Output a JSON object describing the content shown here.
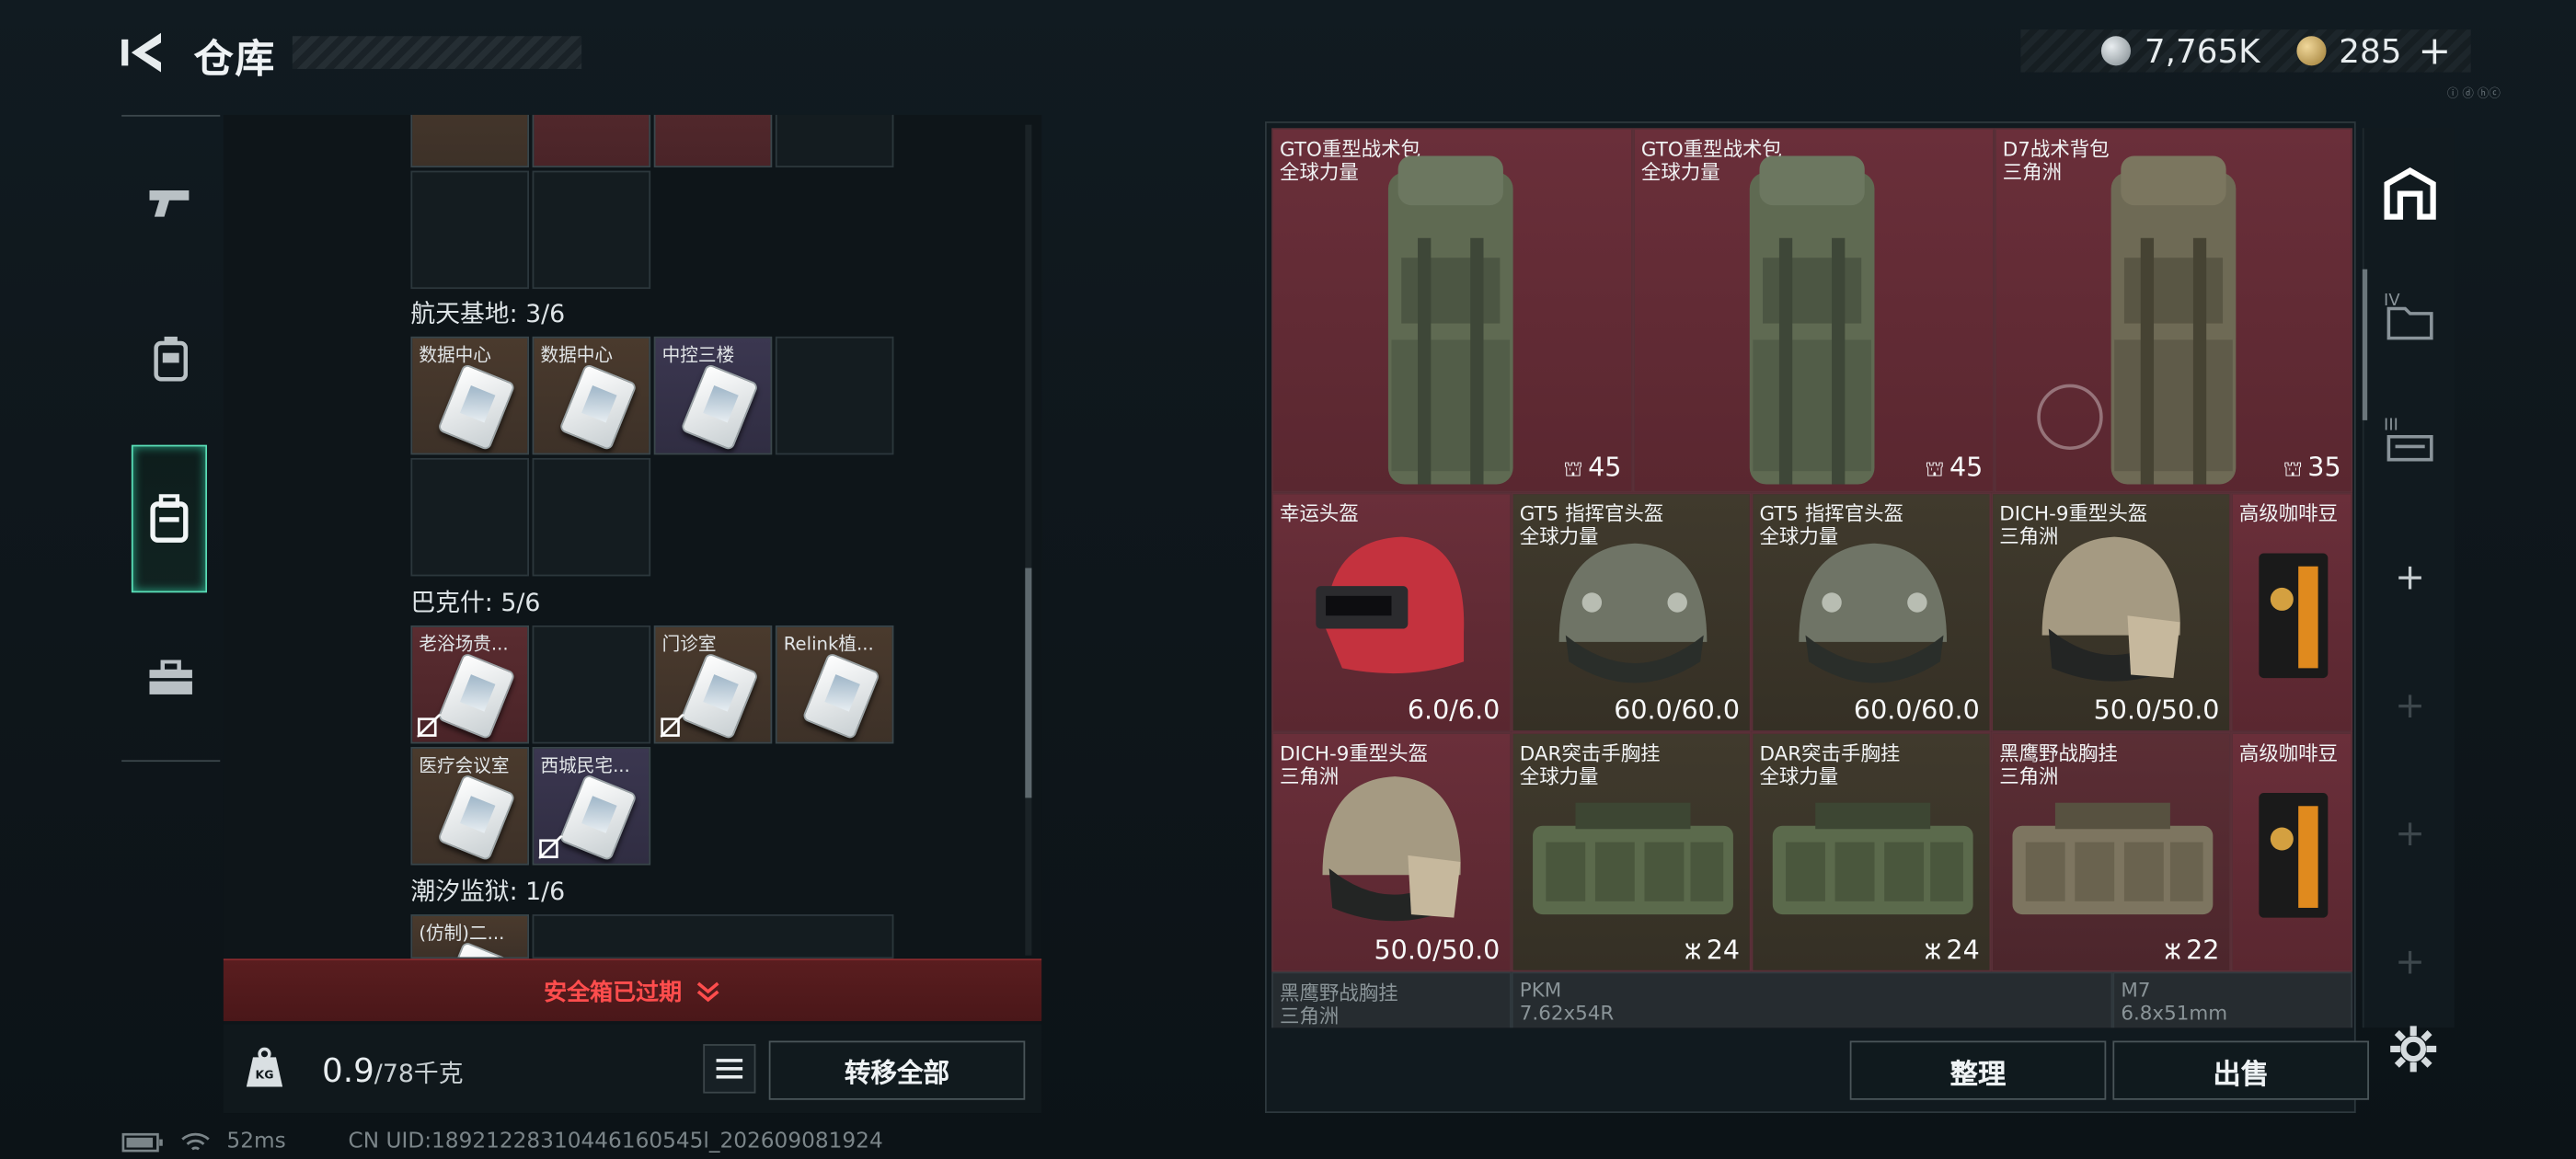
{
  "header": {
    "title": "仓库",
    "currency_silver": "7,765K",
    "currency_gold": "285",
    "plus": "+",
    "tag_text": "ⓘ ⓓ ⓗⓒ"
  },
  "left_sidebar": {
    "items": [
      {
        "icon": "pistol-icon"
      },
      {
        "icon": "chest-rig-icon"
      },
      {
        "icon": "backpack-icon"
      },
      {
        "icon": "toolbox-icon"
      }
    ]
  },
  "keys_panel": {
    "sections": [
      {
        "title": "航天基地: 3/6",
        "items": [
          "数据中心",
          "数据中心",
          "中控三楼"
        ]
      },
      {
        "title": "巴克什: 5/6",
        "items": [
          "老浴场贵...",
          "门诊室",
          "Relink植...",
          "医疗会议室",
          "西城民宅..."
        ]
      },
      {
        "title": "潮汐监狱: 1/6",
        "items": [
          "(仿制)二..."
        ]
      }
    ],
    "warning": "安全箱已过期",
    "weight_value": "0.9",
    "weight_unit": "/78千克",
    "transfer_all": "转移全部",
    "kg_label": "KG"
  },
  "status_bar": {
    "ping": "52ms",
    "uid": "CN UID:18921228310446160545l_202609081924"
  },
  "stash": {
    "items": [
      {
        "name": "GTO重型战术包",
        "sub": "全球力量",
        "value": "45",
        "icon": "capacity-icon"
      },
      {
        "name": "GTO重型战术包",
        "sub": "全球力量",
        "value": "45",
        "icon": "capacity-icon"
      },
      {
        "name": "D7战术背包",
        "sub": "三角洲",
        "value": "35",
        "icon": "capacity-icon"
      },
      {
        "name": "幸运头盔",
        "sub": "",
        "value": "6.0/6.0"
      },
      {
        "name": "GT5 指挥官头盔",
        "sub": "全球力量",
        "value": "60.0/60.0"
      },
      {
        "name": "GT5 指挥官头盔",
        "sub": "全球力量",
        "value": "60.0/60.0"
      },
      {
        "name": "DICH-9重型头盔",
        "sub": "三角洲",
        "value": "50.0/50.0"
      },
      {
        "name": "高级咖啡豆",
        "sub": "",
        "value": ""
      },
      {
        "name": "DICH-9重型头盔",
        "sub": "三角洲",
        "value": "50.0/50.0"
      },
      {
        "name": "DAR突击手胸挂",
        "sub": "全球力量",
        "value": "24",
        "icon": "vest-icon"
      },
      {
        "name": "DAR突击手胸挂",
        "sub": "全球力量",
        "value": "24",
        "icon": "vest-icon"
      },
      {
        "name": "黑鹰野战胸挂",
        "sub": "三角洲",
        "value": "22",
        "icon": "vest-icon"
      },
      {
        "name": "高级咖啡豆",
        "sub": "",
        "value": ""
      },
      {
        "name": "黑鹰野战胸挂",
        "sub": "三角洲",
        "value": ""
      },
      {
        "name": "PKM",
        "sub": "7.62x54R",
        "value": ""
      },
      {
        "name": "M7",
        "sub": "6.8x51mm",
        "value": ""
      }
    ],
    "sort_button": "整理",
    "sell_button": "出售"
  },
  "right_sidebar": {
    "tab_iv": "IV",
    "tab_iii": "III",
    "add": "+"
  },
  "colors": {
    "accent_green": "#5adfb8",
    "warning_red": "#ff4d4d",
    "item_red": "#6a2f3a",
    "item_brown": "#4a3a2d",
    "item_purple": "#3b3750"
  }
}
